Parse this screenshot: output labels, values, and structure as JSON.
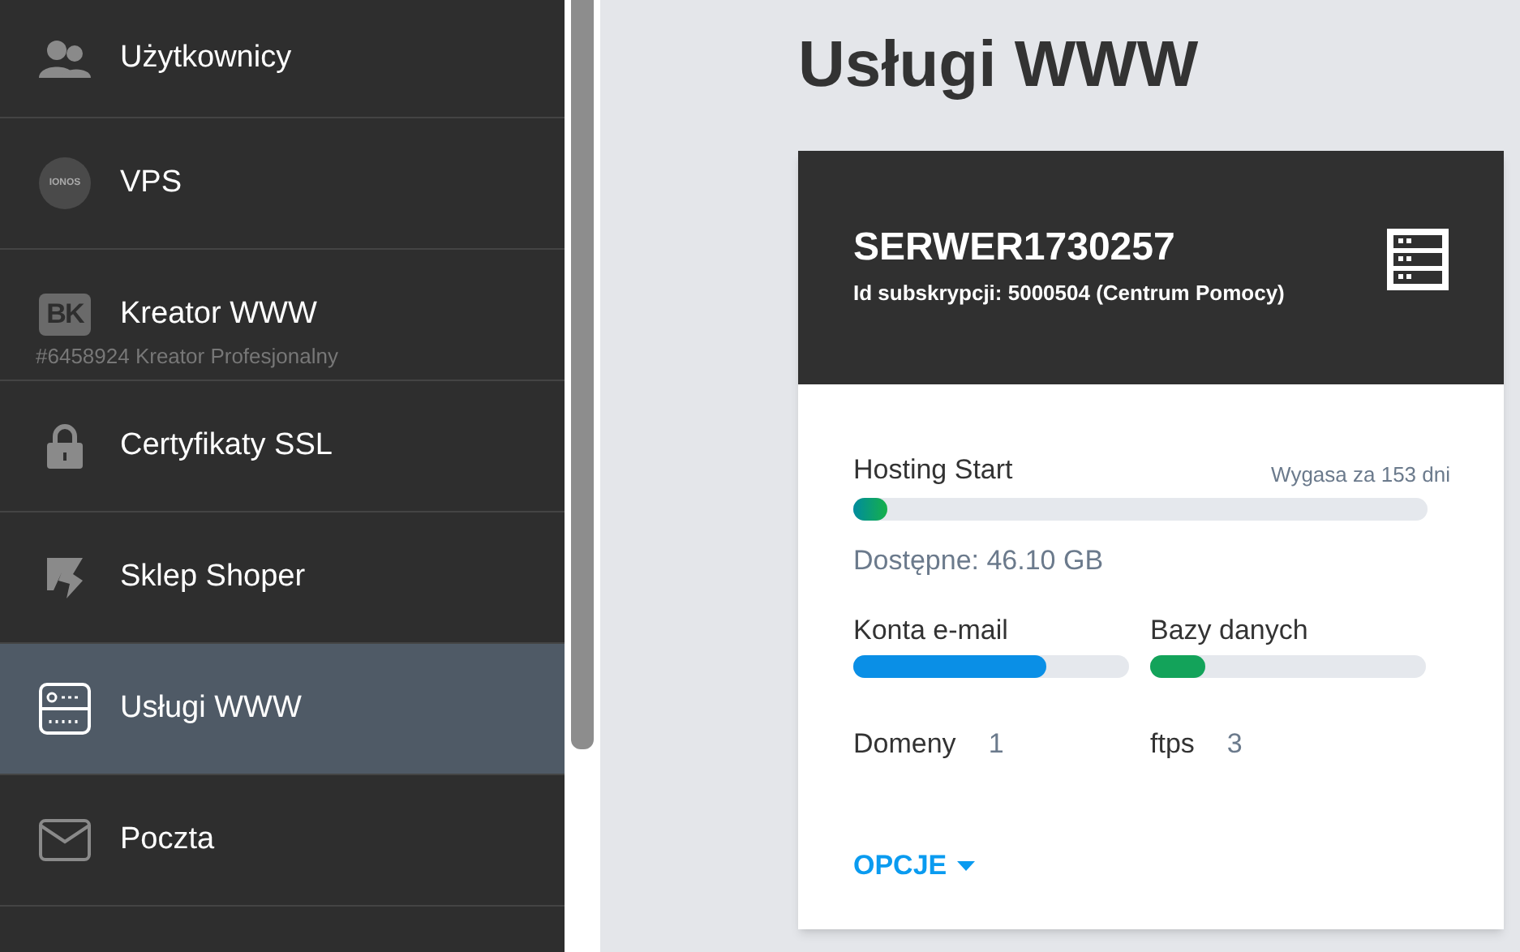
{
  "sidebar": {
    "items": [
      {
        "kind": "users",
        "label": "Użytkownicy",
        "selected": false
      },
      {
        "kind": "circle-logo",
        "logo": "IONOS",
        "label": "VPS",
        "selected": false
      },
      {
        "kind": "square-logo",
        "logo": "BK",
        "label": "Kreator WWW",
        "sub": "#6458924 Kreator Profesjonalny",
        "selected": false
      },
      {
        "kind": "lock",
        "label": "Certyfikaty SSL",
        "selected": false
      },
      {
        "kind": "shop",
        "label": "Sklep Shoper",
        "selected": false
      },
      {
        "kind": "server",
        "label": "Usługi WWW",
        "selected": true
      },
      {
        "kind": "mail",
        "label": "Poczta",
        "selected": false
      }
    ]
  },
  "page_title": "Usługi WWW",
  "card": {
    "name": "SERWER1730257",
    "subtitle": "Id subskrypcji: 5000504 (Centrum Pomocy)",
    "plan": {
      "label": "Hosting Start",
      "expiry": "Wygasa za 153 dni",
      "level": 0.06,
      "available": "Dostępne: 46.10 GB"
    },
    "meters": [
      {
        "label": "Konta e-mail",
        "level": 0.7,
        "color": "#0a8fe6"
      },
      {
        "label": "Bazy danych",
        "level": 0.2,
        "color": "#13a35a"
      }
    ],
    "counts": [
      {
        "label": "Domeny",
        "value": "1"
      },
      {
        "label": "ftps",
        "value": "3"
      }
    ],
    "options": "OPCJE"
  }
}
